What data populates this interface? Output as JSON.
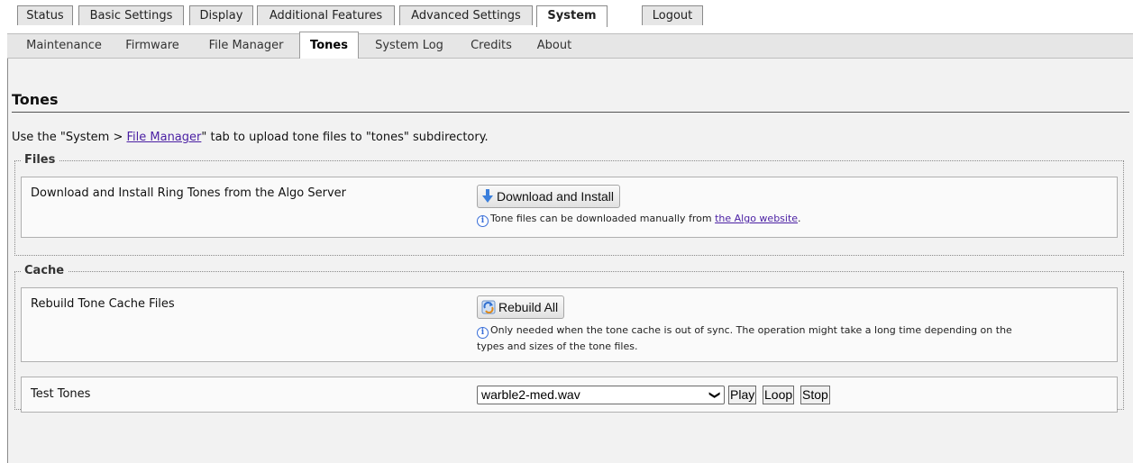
{
  "top_tabs": [
    "Status",
    "Basic Settings",
    "Display",
    "Additional Features",
    "Advanced Settings",
    "System",
    "Logout"
  ],
  "sub_tabs": [
    "Maintenance",
    "Firmware",
    "File Manager",
    "Tones",
    "System Log",
    "Credits",
    "About"
  ],
  "page": {
    "title": "Tones",
    "intro_prefix": "Use the \"System > ",
    "intro_link": "File Manager",
    "intro_suffix": "\" tab to upload tone files to \"tones\" subdirectory."
  },
  "files": {
    "legend": "Files",
    "label": "Download and Install Ring Tones from the Algo Server",
    "button": "Download and Install",
    "note_prefix": "Tone files can be downloaded manually from ",
    "note_link": "the Algo website",
    "note_suffix": "."
  },
  "cache": {
    "legend": "Cache",
    "label": "Rebuild Tone Cache Files",
    "button": "Rebuild All",
    "note_line1": "Only needed when the tone cache is out of sync. The operation might take a long time depending on the",
    "note_line2": "types and sizes of the tone files."
  },
  "test": {
    "label": "Test Tones",
    "selected": "warble2-med.wav",
    "play": "Play",
    "loop": "Loop",
    "stop": "Stop"
  },
  "colors": {
    "link": "#4a1fa3",
    "info": "#3a6fd8",
    "download_icon": "#3b7fdc"
  },
  "icons": {
    "download": "arrow-down-icon",
    "rebuild": "refresh-icon",
    "info": "info-icon",
    "dropdown": "chevron-down-icon"
  }
}
